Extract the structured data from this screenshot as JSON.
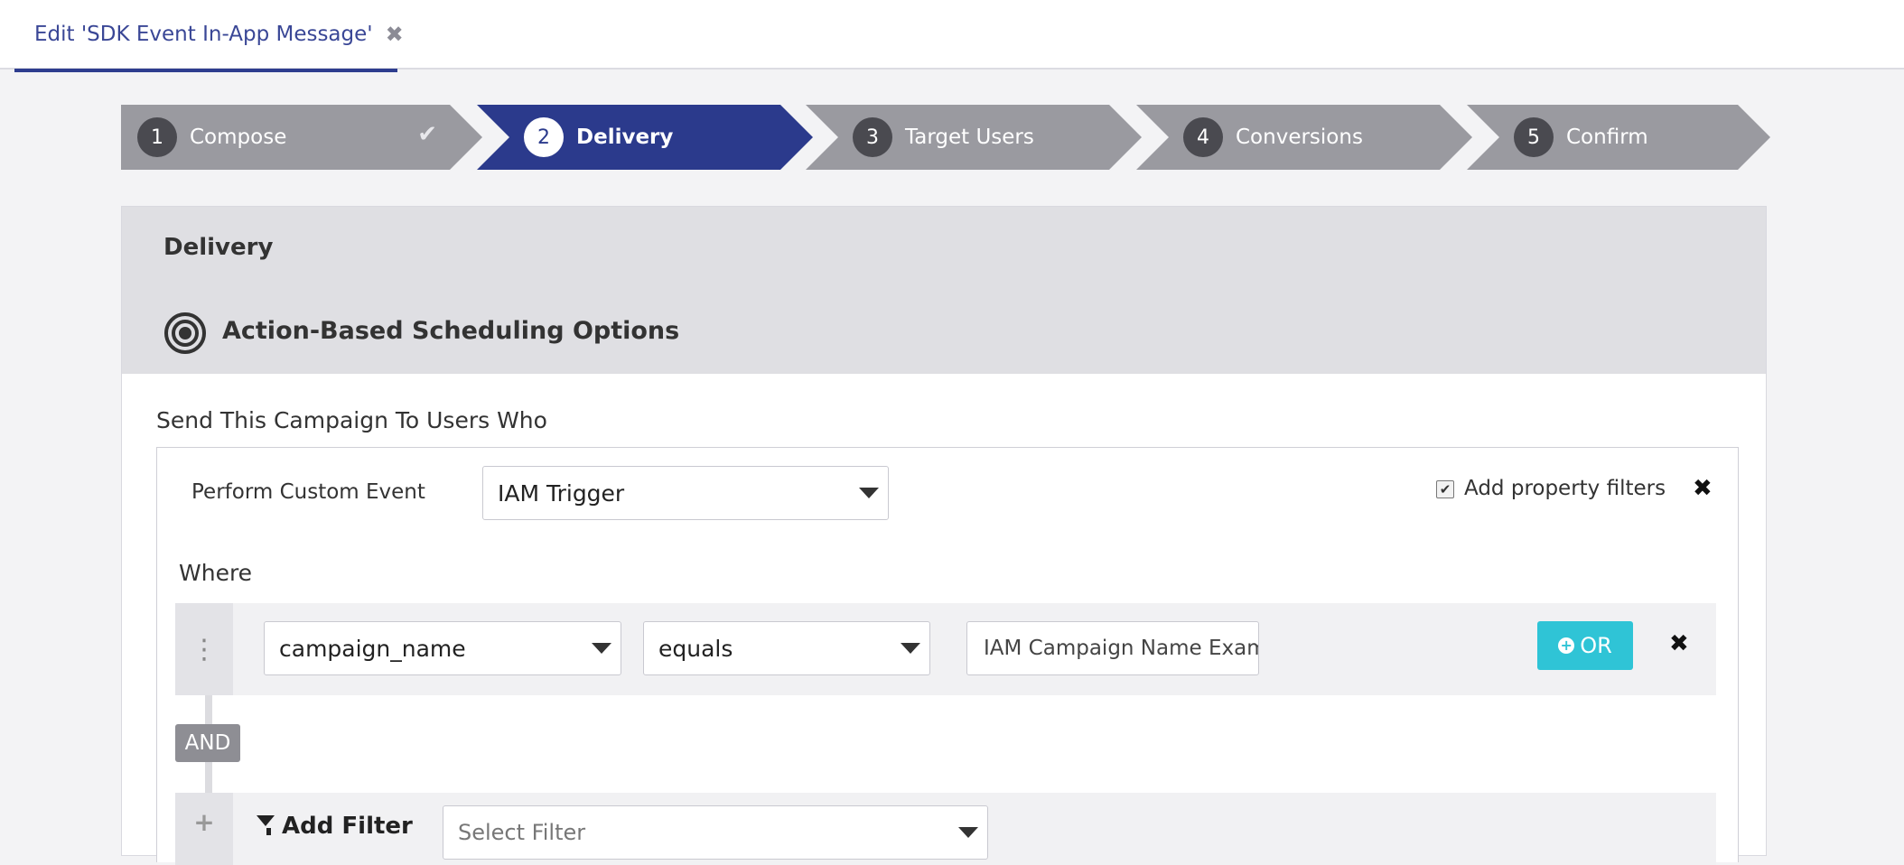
{
  "tab": {
    "label": "Edit 'SDK Event In-App Message'",
    "close_glyph": "✖"
  },
  "stepper": {
    "steps": [
      {
        "num": "1",
        "label": "Compose",
        "state": "done",
        "done_glyph": "✔"
      },
      {
        "num": "2",
        "label": "Delivery",
        "state": "active"
      },
      {
        "num": "3",
        "label": "Target Users",
        "state": "todo"
      },
      {
        "num": "4",
        "label": "Conversions",
        "state": "todo"
      },
      {
        "num": "5",
        "label": "Confirm",
        "state": "todo"
      }
    ],
    "colors": {
      "active": "#2b3a8c",
      "inactive": "#9a9aa0",
      "num_bg_inactive": "#4a4a50"
    }
  },
  "panel": {
    "title": "Delivery",
    "scheduling_title": "Action-Based Scheduling Options",
    "send_label": "Send This Campaign To Users Who"
  },
  "rule": {
    "perform_label": "Perform Custom Event",
    "event_value": "IAM Trigger",
    "add_property_filters_label": "Add property filters",
    "add_property_filters_checked": true,
    "check_glyph": "✔",
    "close_glyph": "✖",
    "where_label": "Where",
    "filter": {
      "handle_glyph": "⋮",
      "property": "campaign_name",
      "operator": "equals",
      "value": "IAM Campaign Name Example",
      "or_label": "OR",
      "or_plus": "+"
    },
    "and_label": "AND",
    "add_filter": {
      "handle_glyph": "+",
      "label": "Add Filter",
      "placeholder": "Select Filter"
    }
  }
}
